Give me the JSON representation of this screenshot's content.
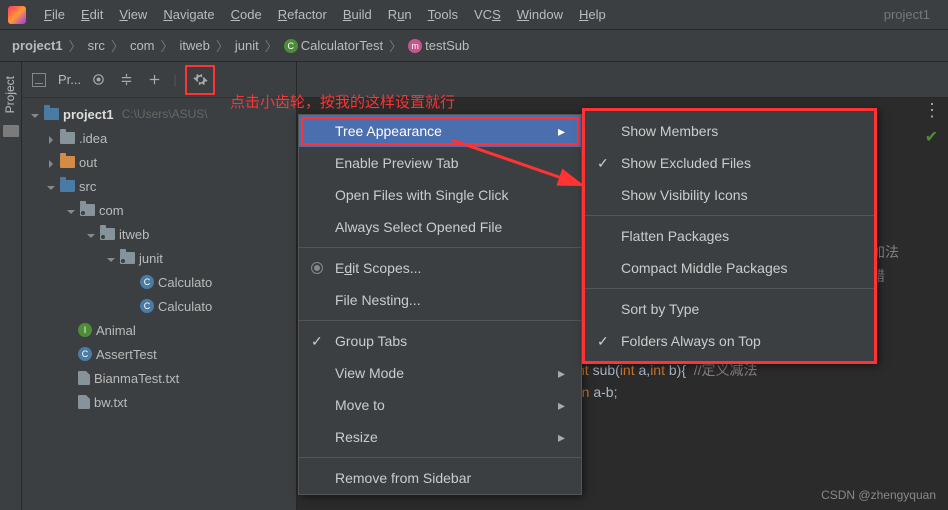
{
  "menubar": [
    "File",
    "Edit",
    "View",
    "Navigate",
    "Code",
    "Refactor",
    "Build",
    "Run",
    "Tools",
    "VCS",
    "Window",
    "Help"
  ],
  "project_name": "project1",
  "breadcrumb": {
    "items": [
      "project1",
      "src",
      "com",
      "itweb",
      "junit",
      "CalculatorTest",
      "testSub"
    ]
  },
  "tool_window_label": "Project",
  "tool_header": "Pr...",
  "tree": {
    "root": "project1",
    "root_hint": "C:\\Users\\ASUS\\",
    "idea": ".idea",
    "out": "out",
    "src": "src",
    "com": "com",
    "itweb": "itweb",
    "junit": "junit",
    "calc1": "Calculato",
    "calc2": "Calculato",
    "animal": "Animal",
    "assert": "AssertTest",
    "bianma": "BianmaTest.txt",
    "bw": "bw.txt"
  },
  "annotation": "点击小齿轮，按我的这样设置就行",
  "popup1": {
    "tree_appearance": "Tree Appearance",
    "enable_preview": "Enable Preview Tab",
    "open_single": "Open Files with Single Click",
    "always_select": "Always Select Opened File",
    "edit_scopes": "Edit Scopes...",
    "file_nesting": "File Nesting...",
    "group_tabs": "Group Tabs",
    "view_mode": "View Mode",
    "move_to": "Move to",
    "resize": "Resize",
    "remove": "Remove from Sidebar"
  },
  "popup2": {
    "show_members": "Show Members",
    "show_excluded": "Show Excluded Files",
    "show_visibility": "Show Visibility Icons",
    "flatten": "Flatten Packages",
    "compact": "Compact Middle Packages",
    "sort_type": "Sort by Type",
    "folders_top": "Folders Always on Top"
  },
  "code": {
    "cn1": "义加法",
    "cn2": "报错",
    "line_sub": "nt sub(int a,int b){  //定义减法",
    "line_ret": "rn a-b;"
  },
  "watermark": "CSDN @zhengyquan"
}
